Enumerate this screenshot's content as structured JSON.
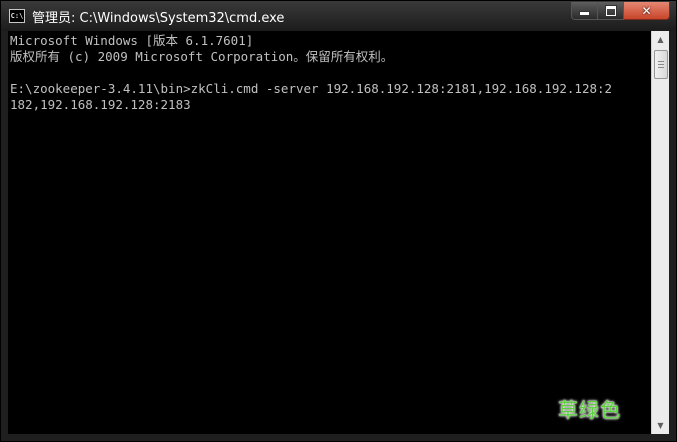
{
  "window": {
    "title": "管理员: C:\\Windows\\System32\\cmd.exe",
    "icon": "console-icon",
    "icon_text": "C:\\"
  },
  "caption_buttons": {
    "minimize_icon": "minimize-icon",
    "maximize_icon": "maximize-icon",
    "close_icon": "close-icon",
    "close_glyph": "✕"
  },
  "console": {
    "lines": [
      "Microsoft Windows [版本 6.1.7601]",
      "版权所有 (c) 2009 Microsoft Corporation。保留所有权利。",
      "",
      "E:\\zookeeper-3.4.11\\bin>zkCli.cmd -server 192.168.192.128:2181,192.168.192.128:2",
      "182,192.168.192.128:2183"
    ],
    "colors": {
      "background": "#000000",
      "text": "#c0c0c0"
    }
  },
  "watermark": {
    "text": "草绿色",
    "color": "#5bd13c"
  },
  "scrollbar": {
    "up_glyph": "▲",
    "down_glyph": "▼"
  }
}
